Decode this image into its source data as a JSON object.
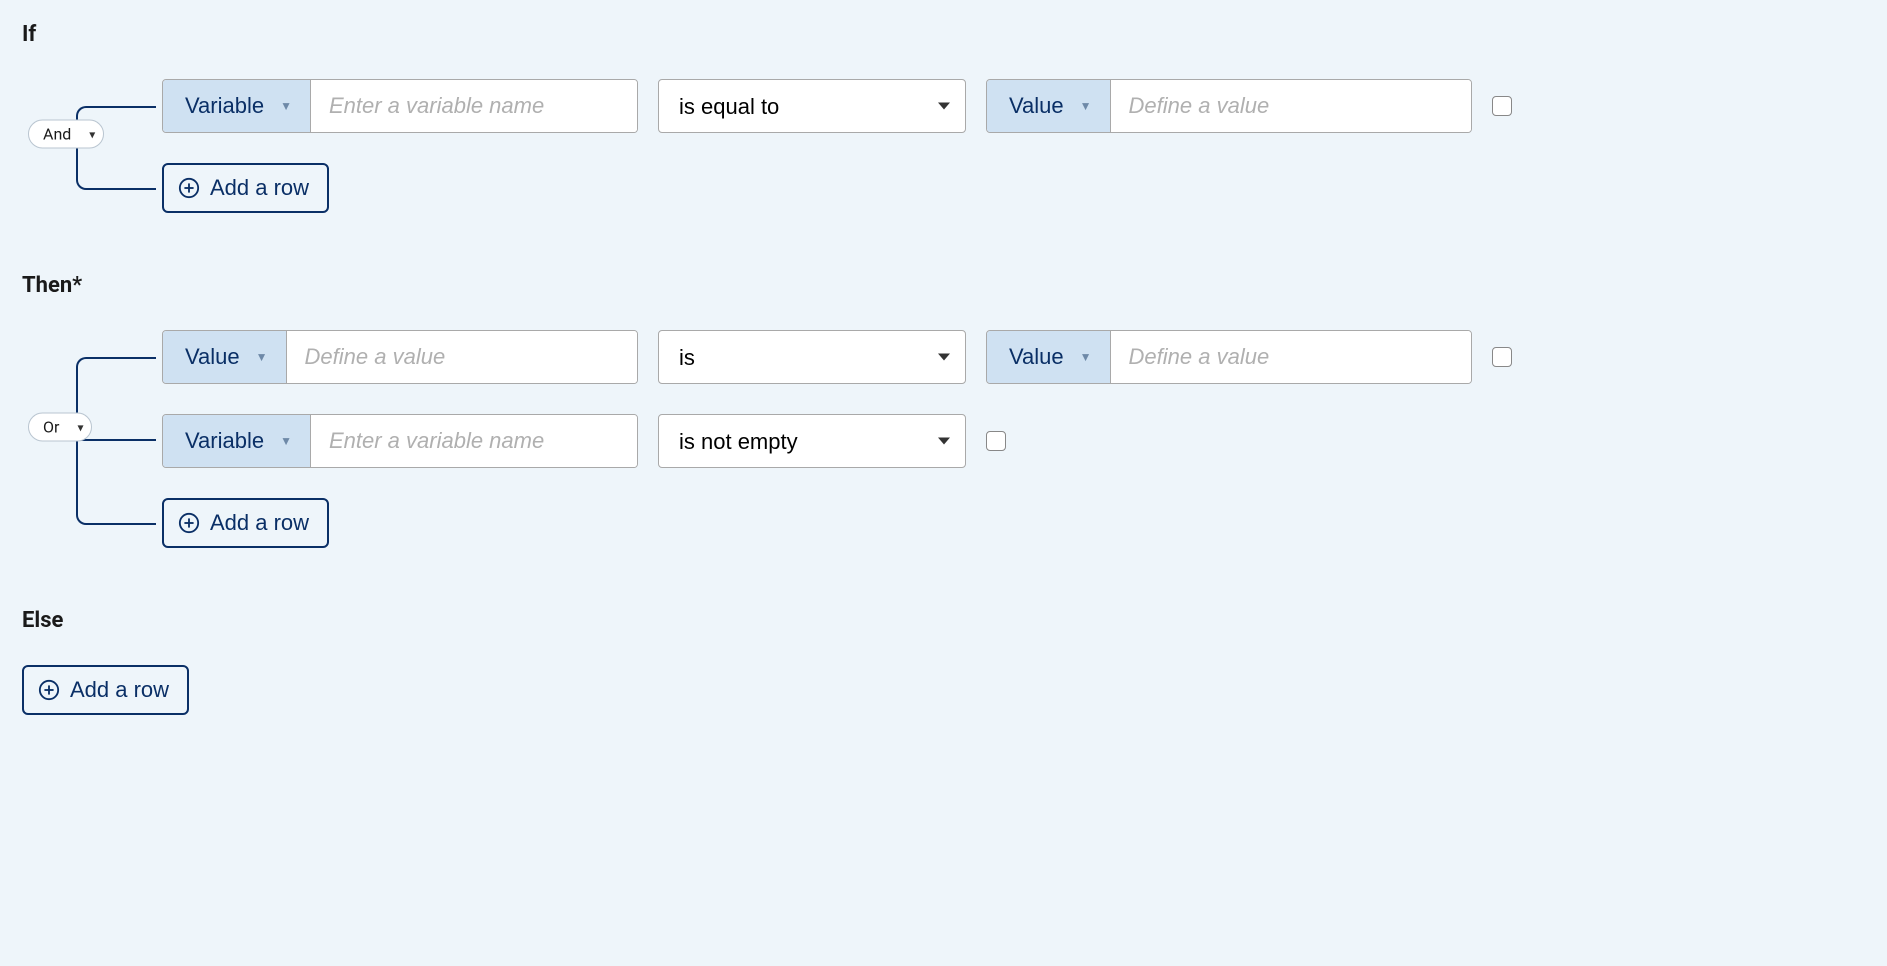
{
  "labels": {
    "if": "If",
    "then": "Then*",
    "else": "Else",
    "add_row": "Add a row"
  },
  "types": {
    "variable": "Variable",
    "value": "Value"
  },
  "placeholders": {
    "variable": "Enter a variable name",
    "value": "Define a value"
  },
  "operators": {
    "is_equal_to": "is equal to",
    "is": "is",
    "is_not_empty": "is not empty"
  },
  "joiners": {
    "and": "And",
    "or": "Or"
  },
  "if_block": {
    "joiner": "And",
    "rows": [
      {
        "left_type": "Variable",
        "left_placeholder": "Enter a variable name",
        "op": "is equal to",
        "right_type": "Value",
        "right_placeholder": "Define a value"
      }
    ]
  },
  "then_block": {
    "joiner": "Or",
    "rows": [
      {
        "left_type": "Value",
        "left_placeholder": "Define a value",
        "op": "is",
        "right_type": "Value",
        "right_placeholder": "Define a value"
      },
      {
        "left_type": "Variable",
        "left_placeholder": "Enter a variable name",
        "op": "is not empty"
      }
    ]
  }
}
